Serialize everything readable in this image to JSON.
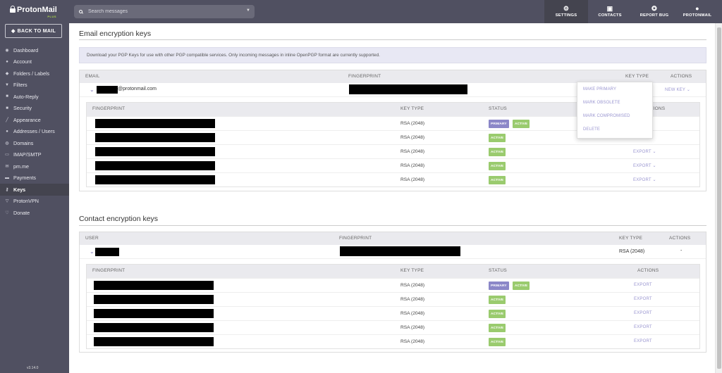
{
  "brand": {
    "name": "ProtonMail",
    "tier": "PLUS",
    "accent": "#a8d448"
  },
  "sidebar": {
    "back_label": "BACK TO MAIL",
    "items": [
      {
        "label": "Dashboard",
        "icon": "dashboard-icon"
      },
      {
        "label": "Account",
        "icon": "user-icon"
      },
      {
        "label": "Folders / Labels",
        "icon": "tag-icon"
      },
      {
        "label": "Filters",
        "icon": "filter-icon"
      },
      {
        "label": "Auto-Reply",
        "icon": "robot-icon"
      },
      {
        "label": "Security",
        "icon": "lock-icon"
      },
      {
        "label": "Appearance",
        "icon": "brush-icon"
      },
      {
        "label": "Addresses / Users",
        "icon": "users-icon"
      },
      {
        "label": "Domains",
        "icon": "globe-icon"
      },
      {
        "label": "IMAP/SMTP",
        "icon": "monitor-icon"
      },
      {
        "label": "pm.me",
        "icon": "envelope-icon"
      },
      {
        "label": "Payments",
        "icon": "card-icon"
      },
      {
        "label": "Keys",
        "icon": "key-icon"
      },
      {
        "label": "ProtonVPN",
        "icon": "vpn-icon"
      },
      {
        "label": "Donate",
        "icon": "heart-icon"
      }
    ],
    "active_item": "Keys",
    "version": "v3.14.0"
  },
  "search": {
    "placeholder": "Search messages"
  },
  "topnav": {
    "settings": "SETTINGS",
    "contacts": "CONTACTS",
    "report_bug": "REPORT BUG",
    "account": "PROTONMAIL"
  },
  "email_keys": {
    "title": "Email encryption keys",
    "alert": "Download your PGP Keys for use with other PGP compatible services. Only incoming messages in inline OpenPGP format are currently supported.",
    "headers": {
      "email": "EMAIL",
      "fingerprint": "FINGERPRINT",
      "key_type": "KEY TYPE",
      "actions": "ACTIONS"
    },
    "address_suffix": "@protonmail.com",
    "new_key": "NEW KEY",
    "inner_headers": {
      "fingerprint": "FINGERPRINT",
      "key_type": "KEY TYPE",
      "status": "STATUS",
      "actions": "ACTIONS"
    },
    "rows": [
      {
        "key_type": "RSA (2048)",
        "primary": "PRIMARY",
        "status": "ACTIVE",
        "action": ""
      },
      {
        "key_type": "RSA (2048)",
        "status": "ACTIVE",
        "action": ""
      },
      {
        "key_type": "RSA (2048)",
        "status": "ACTIVE",
        "action": "EXPORT"
      },
      {
        "key_type": "RSA (2048)",
        "status": "ACTIVE",
        "action": "EXPORT"
      },
      {
        "key_type": "RSA (2048)",
        "status": "ACTIVE",
        "action": "EXPORT"
      }
    ]
  },
  "dropdown": {
    "items": [
      "MAKE PRIMARY",
      "MARK OBSOLETE",
      "MARK COMPROMISED",
      "DELETE"
    ]
  },
  "contact_keys": {
    "title": "Contact encryption keys",
    "headers": {
      "user": "USER",
      "fingerprint": "FINGERPRINT",
      "key_type": "KEY TYPE",
      "actions": "ACTIONS"
    },
    "summary_key_type": "RSA (2048)",
    "summary_action": "-",
    "inner_headers": {
      "fingerprint": "FINGERPRINT",
      "key_type": "KEY TYPE",
      "status": "STATUS",
      "actions": "ACTIONS"
    },
    "rows": [
      {
        "key_type": "RSA (2048)",
        "primary": "PRIMARY",
        "status": "ACTIVE",
        "action": "EXPORT"
      },
      {
        "key_type": "RSA (2048)",
        "status": "ACTIVE",
        "action": "EXPORT"
      },
      {
        "key_type": "RSA (2048)",
        "status": "ACTIVE",
        "action": "EXPORT"
      },
      {
        "key_type": "RSA (2048)",
        "status": "ACTIVE",
        "action": "EXPORT"
      },
      {
        "key_type": "RSA (2048)",
        "status": "ACTIVE",
        "action": "EXPORT"
      }
    ]
  }
}
